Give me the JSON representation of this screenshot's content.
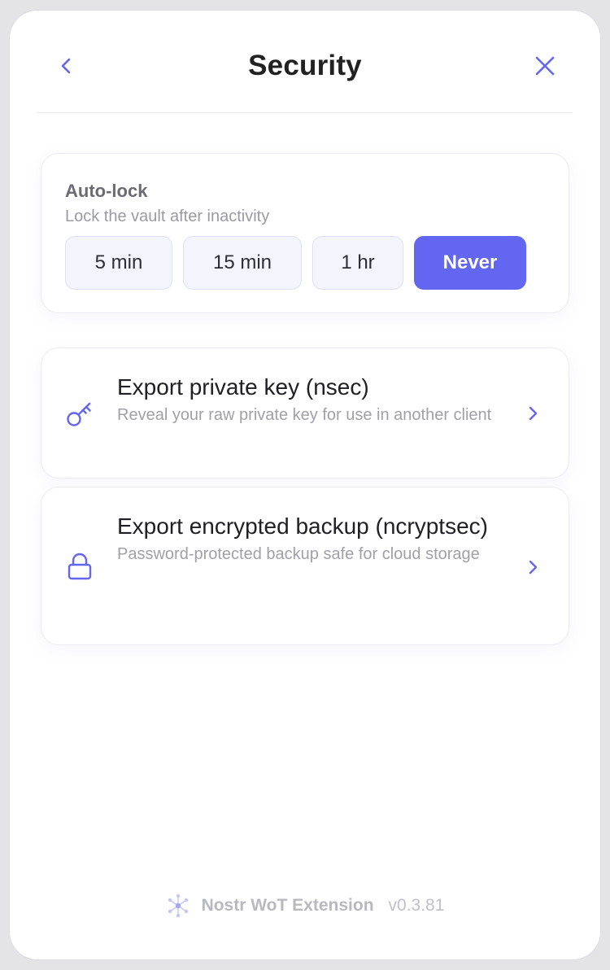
{
  "header": {
    "title": "Security",
    "back_icon": "chevron-left-icon",
    "close_icon": "close-icon"
  },
  "autolock": {
    "title": "Auto-lock",
    "subtitle": "Lock the vault after inactivity",
    "options": [
      {
        "label": "5 min",
        "selected": false
      },
      {
        "label": "15 min",
        "selected": false
      },
      {
        "label": "1 hr",
        "selected": false
      },
      {
        "label": "Never",
        "selected": true
      }
    ]
  },
  "actions": [
    {
      "icon": "key-icon",
      "title": "Export private key (nsec)",
      "description": "Reveal your raw private key for use in another client"
    },
    {
      "icon": "lock-icon",
      "title": "Export encrypted backup (ncryptsec)",
      "description": "Password-protected backup safe for cloud storage"
    }
  ],
  "footer": {
    "logo_icon": "network-logo-icon",
    "name": "Nostr WoT Extension",
    "version": "v0.3.81"
  },
  "colors": {
    "accent": "#6366f1",
    "title_text": "#222222",
    "muted_text": "#a0a0a8"
  }
}
